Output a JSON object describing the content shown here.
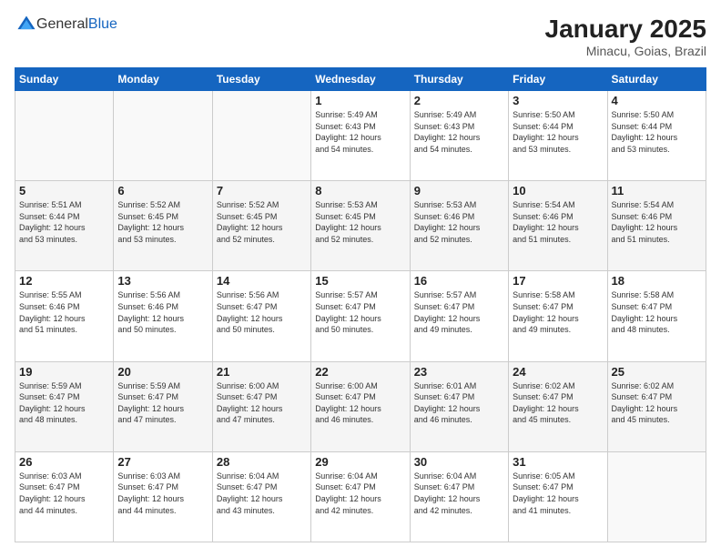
{
  "logo": {
    "general": "General",
    "blue": "Blue"
  },
  "header": {
    "month": "January 2025",
    "location": "Minacu, Goias, Brazil"
  },
  "weekdays": [
    "Sunday",
    "Monday",
    "Tuesday",
    "Wednesday",
    "Thursday",
    "Friday",
    "Saturday"
  ],
  "weeks": [
    [
      {
        "day": "",
        "info": ""
      },
      {
        "day": "",
        "info": ""
      },
      {
        "day": "",
        "info": ""
      },
      {
        "day": "1",
        "info": "Sunrise: 5:49 AM\nSunset: 6:43 PM\nDaylight: 12 hours\nand 54 minutes."
      },
      {
        "day": "2",
        "info": "Sunrise: 5:49 AM\nSunset: 6:43 PM\nDaylight: 12 hours\nand 54 minutes."
      },
      {
        "day": "3",
        "info": "Sunrise: 5:50 AM\nSunset: 6:44 PM\nDaylight: 12 hours\nand 53 minutes."
      },
      {
        "day": "4",
        "info": "Sunrise: 5:50 AM\nSunset: 6:44 PM\nDaylight: 12 hours\nand 53 minutes."
      }
    ],
    [
      {
        "day": "5",
        "info": "Sunrise: 5:51 AM\nSunset: 6:44 PM\nDaylight: 12 hours\nand 53 minutes."
      },
      {
        "day": "6",
        "info": "Sunrise: 5:52 AM\nSunset: 6:45 PM\nDaylight: 12 hours\nand 53 minutes."
      },
      {
        "day": "7",
        "info": "Sunrise: 5:52 AM\nSunset: 6:45 PM\nDaylight: 12 hours\nand 52 minutes."
      },
      {
        "day": "8",
        "info": "Sunrise: 5:53 AM\nSunset: 6:45 PM\nDaylight: 12 hours\nand 52 minutes."
      },
      {
        "day": "9",
        "info": "Sunrise: 5:53 AM\nSunset: 6:46 PM\nDaylight: 12 hours\nand 52 minutes."
      },
      {
        "day": "10",
        "info": "Sunrise: 5:54 AM\nSunset: 6:46 PM\nDaylight: 12 hours\nand 51 minutes."
      },
      {
        "day": "11",
        "info": "Sunrise: 5:54 AM\nSunset: 6:46 PM\nDaylight: 12 hours\nand 51 minutes."
      }
    ],
    [
      {
        "day": "12",
        "info": "Sunrise: 5:55 AM\nSunset: 6:46 PM\nDaylight: 12 hours\nand 51 minutes."
      },
      {
        "day": "13",
        "info": "Sunrise: 5:56 AM\nSunset: 6:46 PM\nDaylight: 12 hours\nand 50 minutes."
      },
      {
        "day": "14",
        "info": "Sunrise: 5:56 AM\nSunset: 6:47 PM\nDaylight: 12 hours\nand 50 minutes."
      },
      {
        "day": "15",
        "info": "Sunrise: 5:57 AM\nSunset: 6:47 PM\nDaylight: 12 hours\nand 50 minutes."
      },
      {
        "day": "16",
        "info": "Sunrise: 5:57 AM\nSunset: 6:47 PM\nDaylight: 12 hours\nand 49 minutes."
      },
      {
        "day": "17",
        "info": "Sunrise: 5:58 AM\nSunset: 6:47 PM\nDaylight: 12 hours\nand 49 minutes."
      },
      {
        "day": "18",
        "info": "Sunrise: 5:58 AM\nSunset: 6:47 PM\nDaylight: 12 hours\nand 48 minutes."
      }
    ],
    [
      {
        "day": "19",
        "info": "Sunrise: 5:59 AM\nSunset: 6:47 PM\nDaylight: 12 hours\nand 48 minutes."
      },
      {
        "day": "20",
        "info": "Sunrise: 5:59 AM\nSunset: 6:47 PM\nDaylight: 12 hours\nand 47 minutes."
      },
      {
        "day": "21",
        "info": "Sunrise: 6:00 AM\nSunset: 6:47 PM\nDaylight: 12 hours\nand 47 minutes."
      },
      {
        "day": "22",
        "info": "Sunrise: 6:00 AM\nSunset: 6:47 PM\nDaylight: 12 hours\nand 46 minutes."
      },
      {
        "day": "23",
        "info": "Sunrise: 6:01 AM\nSunset: 6:47 PM\nDaylight: 12 hours\nand 46 minutes."
      },
      {
        "day": "24",
        "info": "Sunrise: 6:02 AM\nSunset: 6:47 PM\nDaylight: 12 hours\nand 45 minutes."
      },
      {
        "day": "25",
        "info": "Sunrise: 6:02 AM\nSunset: 6:47 PM\nDaylight: 12 hours\nand 45 minutes."
      }
    ],
    [
      {
        "day": "26",
        "info": "Sunrise: 6:03 AM\nSunset: 6:47 PM\nDaylight: 12 hours\nand 44 minutes."
      },
      {
        "day": "27",
        "info": "Sunrise: 6:03 AM\nSunset: 6:47 PM\nDaylight: 12 hours\nand 44 minutes."
      },
      {
        "day": "28",
        "info": "Sunrise: 6:04 AM\nSunset: 6:47 PM\nDaylight: 12 hours\nand 43 minutes."
      },
      {
        "day": "29",
        "info": "Sunrise: 6:04 AM\nSunset: 6:47 PM\nDaylight: 12 hours\nand 42 minutes."
      },
      {
        "day": "30",
        "info": "Sunrise: 6:04 AM\nSunset: 6:47 PM\nDaylight: 12 hours\nand 42 minutes."
      },
      {
        "day": "31",
        "info": "Sunrise: 6:05 AM\nSunset: 6:47 PM\nDaylight: 12 hours\nand 41 minutes."
      },
      {
        "day": "",
        "info": ""
      }
    ]
  ]
}
